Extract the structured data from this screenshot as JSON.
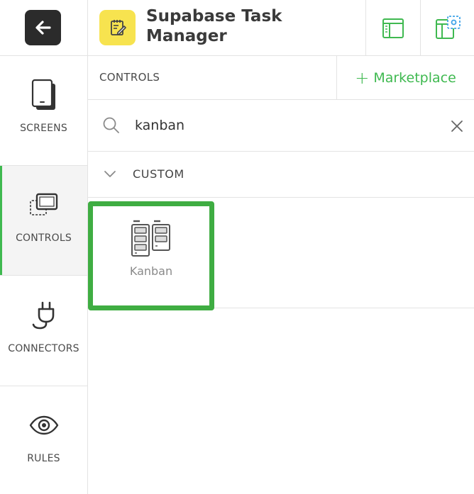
{
  "app": {
    "title": "Supabase Task Manager"
  },
  "nav": {
    "items": [
      {
        "label": "SCREENS",
        "icon": "tablet-icon"
      },
      {
        "label": "CONTROLS",
        "icon": "controls-icon",
        "active": true
      },
      {
        "label": "CONNECTORS",
        "icon": "plug-icon"
      },
      {
        "label": "RULES",
        "icon": "eye-icon"
      }
    ]
  },
  "panel": {
    "title": "CONTROLS",
    "marketplace_label": "Marketplace",
    "search": {
      "value": "kanban",
      "placeholder": ""
    },
    "section": {
      "label": "CUSTOM"
    },
    "controls": [
      {
        "label": "Kanban",
        "icon": "kanban-icon"
      }
    ]
  },
  "colors": {
    "accent": "#3fb950",
    "tile_border": "#3fad42",
    "back_button": "#2b2b2b",
    "app_icon_bg": "#f7e34f"
  }
}
